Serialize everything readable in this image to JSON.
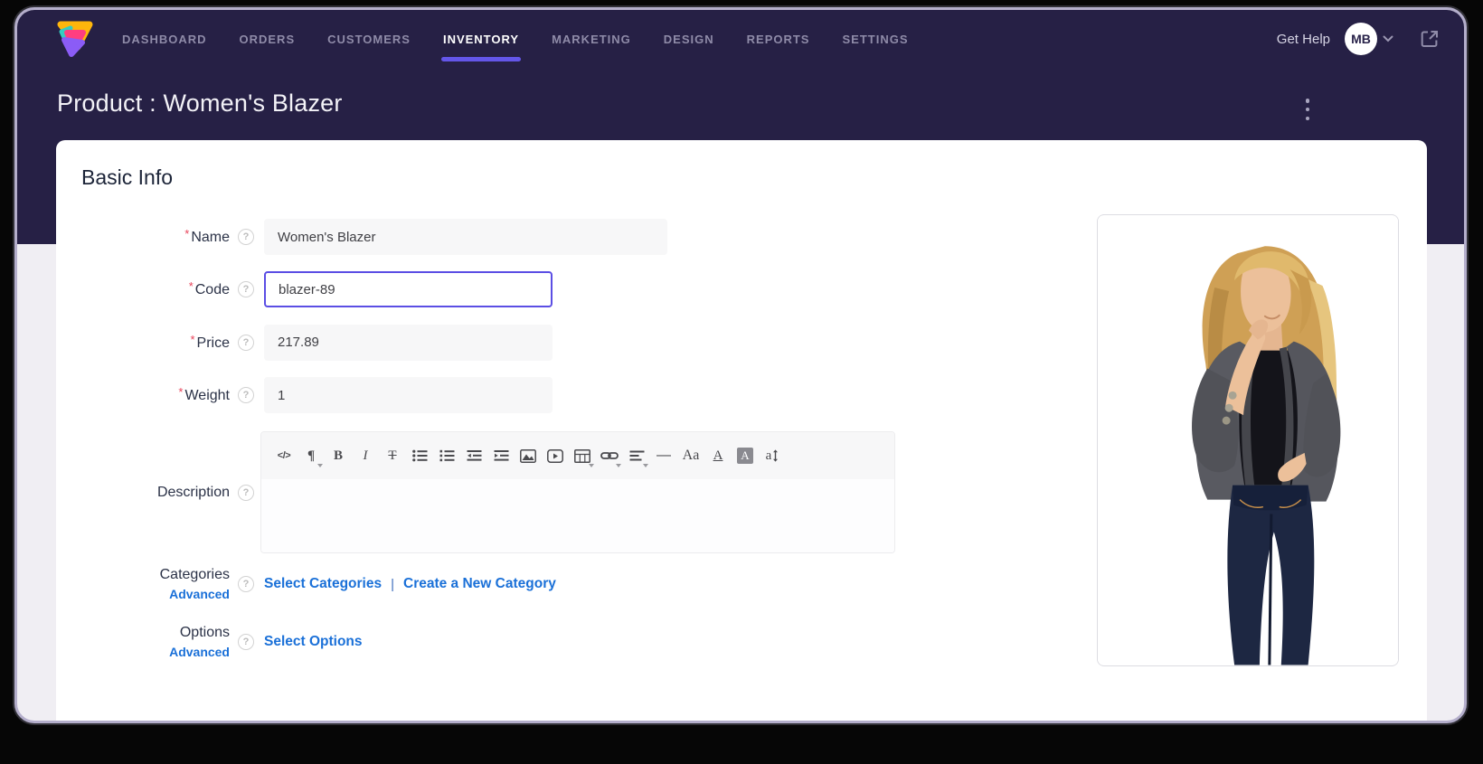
{
  "nav": {
    "items": [
      {
        "label": "DASHBOARD",
        "active": false
      },
      {
        "label": "ORDERS",
        "active": false
      },
      {
        "label": "CUSTOMERS",
        "active": false
      },
      {
        "label": "INVENTORY",
        "active": true
      },
      {
        "label": "MARKETING",
        "active": false
      },
      {
        "label": "DESIGN",
        "active": false
      },
      {
        "label": "REPORTS",
        "active": false
      },
      {
        "label": "SETTINGS",
        "active": false
      }
    ],
    "get_help_label": "Get Help",
    "avatar_initials": "MB"
  },
  "page": {
    "title": "Product : Women's Blazer"
  },
  "section": {
    "heading": "Basic Info"
  },
  "ui": {
    "required_marker": "*",
    "help_glyph": "?",
    "pipe": "|"
  },
  "fields": {
    "name": {
      "label": "Name",
      "required": true,
      "value": "Women's Blazer"
    },
    "code": {
      "label": "Code",
      "required": true,
      "value": "blazer-89",
      "focused": true
    },
    "price": {
      "label": "Price",
      "required": true,
      "value": "217.89"
    },
    "weight": {
      "label": "Weight",
      "required": true,
      "value": "1"
    },
    "description": {
      "label": "Description",
      "value": ""
    },
    "categories": {
      "label": "Categories",
      "advanced_label": "Advanced",
      "link_select": "Select Categories",
      "link_create": "Create a New Category"
    },
    "options": {
      "label": "Options",
      "advanced_label": "Advanced",
      "link_select": "Select Options"
    }
  },
  "editor": {
    "toolbar_icons": [
      "code-view",
      "paragraph-format",
      "bold",
      "italic",
      "strikethrough",
      "unordered-list",
      "ordered-list",
      "outdent",
      "indent",
      "insert-image",
      "insert-video",
      "insert-table",
      "insert-link",
      "align",
      "horizontal-rule",
      "font-family",
      "text-color",
      "background-color",
      "line-height"
    ],
    "glyphs": {
      "code": "</>",
      "paragraph": "¶",
      "bold": "B",
      "italic": "I",
      "strike": "T",
      "hr": "—",
      "font_family": "Aa",
      "text_color": "A",
      "bg_color": "A",
      "line_height": "a"
    }
  },
  "image_panel": {
    "alt": "Woman with blonde hair wearing an open grey blazer over a black top and dark jeans"
  },
  "colors": {
    "header_bg": "#262045",
    "accent_underline": "#6456e8",
    "focus_border": "#5b4ee4",
    "link_blue": "#1a70d8",
    "required_red": "#e8435a",
    "body_bg": "#f0eef3",
    "input_bg": "#f7f7f8"
  }
}
